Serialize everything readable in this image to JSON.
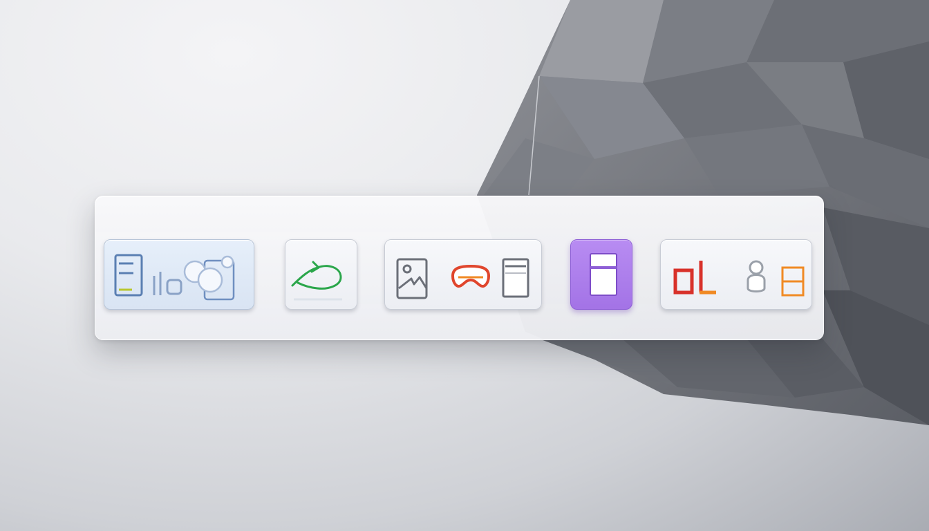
{
  "dock": {
    "items": [
      {
        "name": "analytics-app",
        "icons": [
          "document-lines-icon",
          "bar-icon",
          "chat-bubbles-icon"
        ]
      },
      {
        "name": "sync-app",
        "icons": [
          "curved-arrow-icon"
        ]
      },
      {
        "name": "workspace-app",
        "icons": [
          "photo-frame-icon",
          "gamepad-icon",
          "notes-icon"
        ]
      },
      {
        "name": "layout-app",
        "icons": [
          "split-window-icon"
        ]
      },
      {
        "name": "tools-app",
        "icons": [
          "chart-columns-icon",
          "user-icon",
          "grid-icon"
        ]
      }
    ],
    "active_index": 3
  },
  "colors": {
    "dock_background": "#f3f4f7",
    "active_tile": "#a97ae8",
    "green_accent": "#2aa64a",
    "red_accent": "#d8312a",
    "orange_accent": "#f08a24",
    "blue_accent": "#5a7fb2"
  }
}
